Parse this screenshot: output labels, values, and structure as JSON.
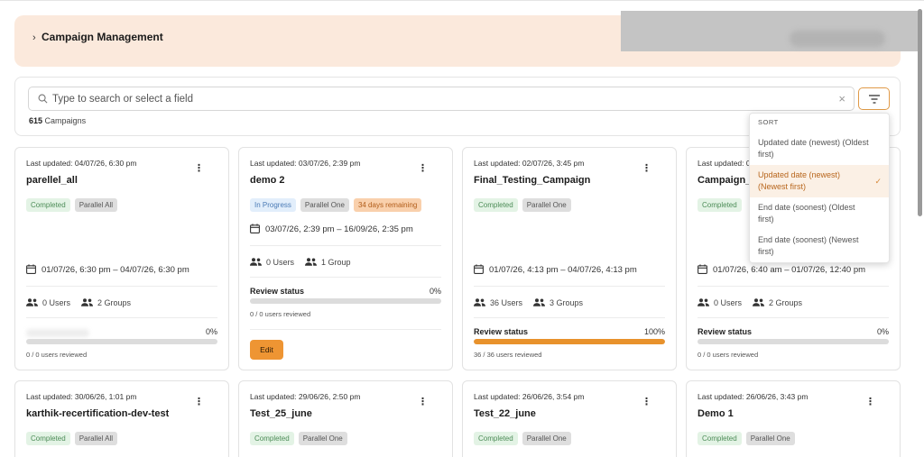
{
  "header": {
    "title": "Campaign Management"
  },
  "search": {
    "placeholder": "Type to search or select a field"
  },
  "summary": {
    "count": "615",
    "count_label": "Campaigns"
  },
  "sort_menu": {
    "heading": "SORT",
    "options": [
      {
        "label": "Updated date (newest) (Oldest first)",
        "selected": false
      },
      {
        "label": "Updated date (newest) (Newest first)",
        "selected": true
      },
      {
        "label": "End date (soonest) (Oldest first)",
        "selected": false
      },
      {
        "label": "End date (soonest) (Newest first)",
        "selected": false
      }
    ]
  },
  "cards": [
    {
      "updated": "Last updated: 04/07/26, 6:30 pm",
      "name": "parellel_all",
      "status": "Completed",
      "type": "Parallel All",
      "range": "01/07/26, 6:30 pm – 04/07/26, 6:30 pm",
      "users": "0 Users",
      "groups": "2 Groups",
      "review_pct": "0%",
      "reviewed": "0 / 0 users reviewed",
      "progress": 0
    },
    {
      "updated": "Last updated: 03/07/26, 2:39 pm",
      "name": "demo 2",
      "status": "In Progress",
      "type": "Parallel One",
      "remaining": "34 days remaining",
      "range": "03/07/26, 2:39 pm – 16/09/26, 2:35 pm",
      "users": "0 Users",
      "groups": "1 Group",
      "review_label": "Review status",
      "review_pct": "0%",
      "reviewed": "0 / 0 users reviewed",
      "edit": "Edit",
      "progress": 0
    },
    {
      "updated": "Last updated: 02/07/26, 3:45 pm",
      "name": "Final_Testing_Campaign",
      "status": "Completed",
      "type": "Parallel One",
      "range": "01/07/26, 4:13 pm – 04/07/26, 4:13 pm",
      "users": "36 Users",
      "groups": "3 Groups",
      "review_label": "Review status",
      "review_pct": "100%",
      "reviewed": "36 / 36 users reviewed",
      "progress": 100
    },
    {
      "updated": "Last updated: 0",
      "name": "Campaign_",
      "status": "Completed",
      "type": "",
      "range": "01/07/26, 6:40 am – 01/07/26, 12:40 pm",
      "users": "0 Users",
      "groups": "2 Groups",
      "review_label": "Review status",
      "review_pct": "0%",
      "reviewed": "0 / 0 users reviewed",
      "progress": 0
    },
    {
      "updated": "Last updated: 30/06/26, 1:01 pm",
      "name": "karthik-recertification-dev-test",
      "status": "Completed",
      "type": "Parallel All"
    },
    {
      "updated": "Last updated: 29/06/26, 2:50 pm",
      "name": "Test_25_june",
      "status": "Completed",
      "type": "Parallel One"
    },
    {
      "updated": "Last updated: 26/06/26, 3:54 pm",
      "name": "Test_22_june",
      "status": "Completed",
      "type": "Parallel One"
    },
    {
      "updated": "Last updated: 26/06/26, 3:43 pm",
      "name": "Demo 1",
      "status": "Completed",
      "type": "Parallel One"
    }
  ],
  "colors": {
    "accent": "#e8922c",
    "banner": "#fbe9dc",
    "completed_bg": "#e3f3e5",
    "in_progress_bg": "#e2eefb",
    "remaining_bg": "#f9d0ac"
  }
}
